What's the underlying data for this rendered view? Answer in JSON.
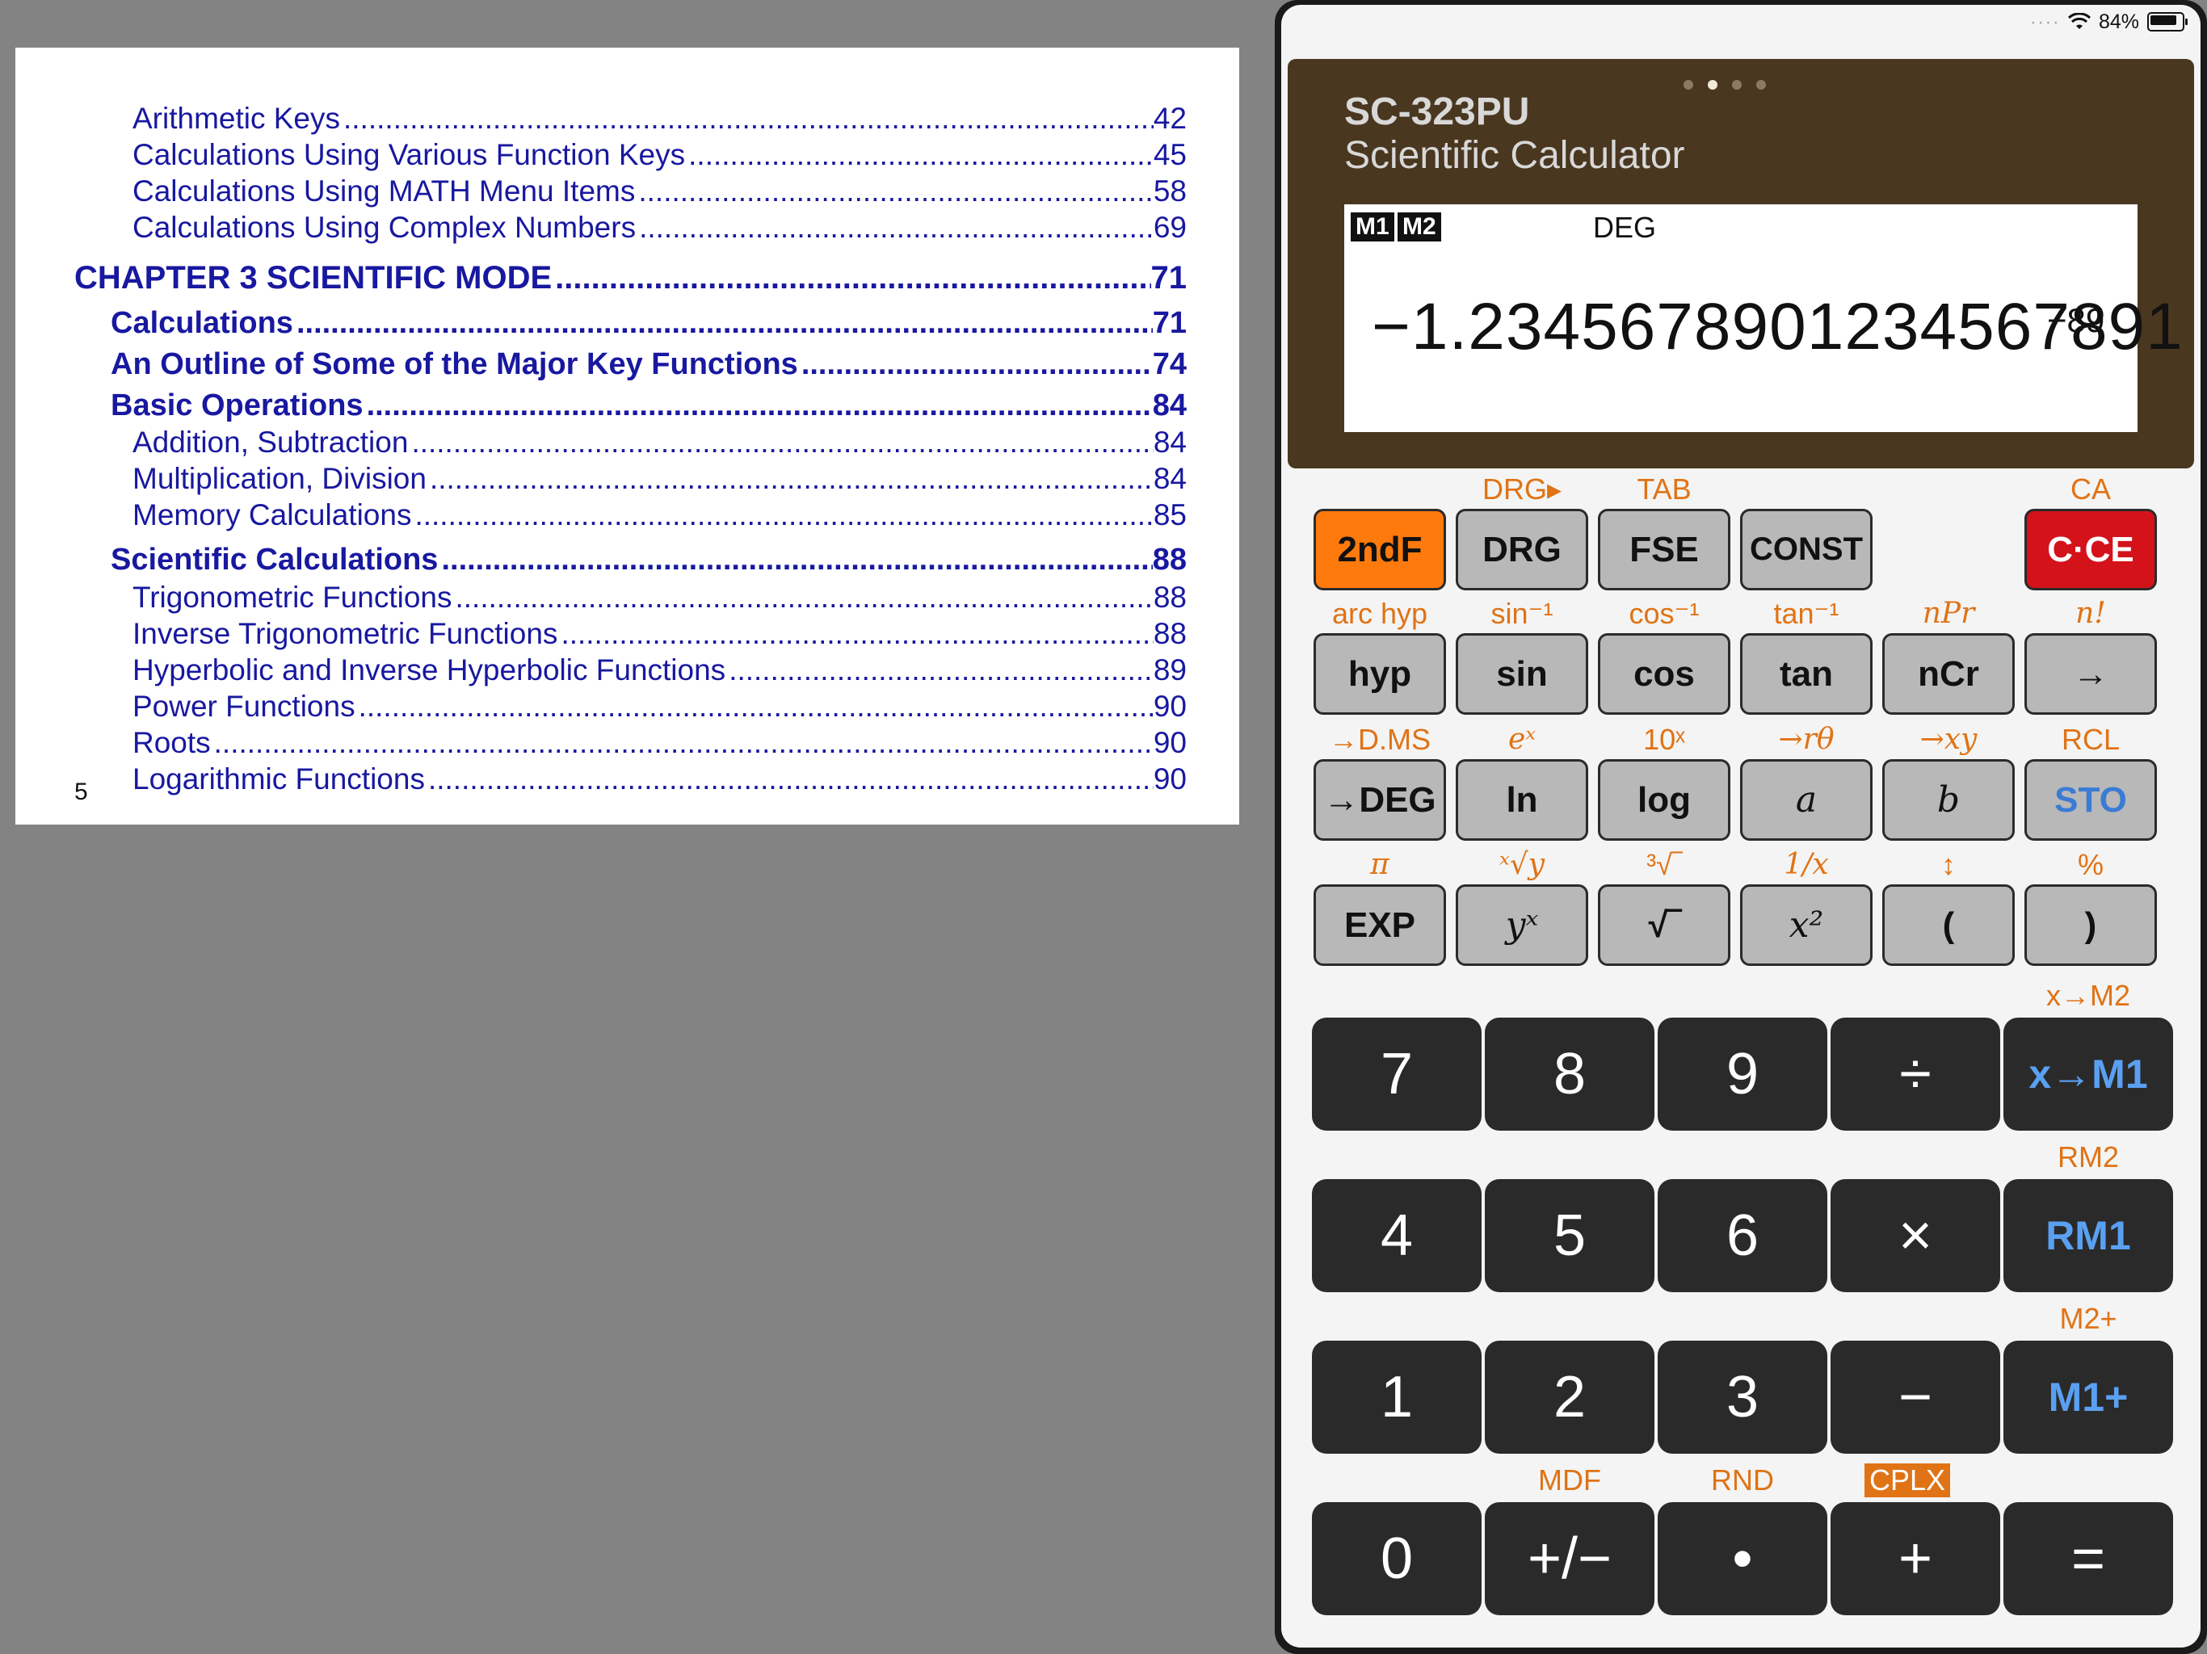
{
  "document": {
    "toc": [
      {
        "title": "Arithmetic Keys",
        "page": "42",
        "level": 3
      },
      {
        "title": "Calculations Using Various Function Keys",
        "page": "45",
        "level": 3
      },
      {
        "title": "Calculations Using MATH Menu Items",
        "page": "58",
        "level": 3
      },
      {
        "title": "Calculations Using Complex Numbers",
        "page": "69",
        "level": 3
      },
      {
        "title": "CHAPTER 3 SCIENTIFIC MODE",
        "page": "71",
        "level": 1
      },
      {
        "title": "Calculations",
        "page": "71",
        "level": 2
      },
      {
        "title": "An Outline of Some of the Major Key Functions",
        "page": "74",
        "level": 2
      },
      {
        "title": "Basic Operations",
        "page": "84",
        "level": 2
      },
      {
        "title": "Addition, Subtraction",
        "page": "84",
        "level": 3
      },
      {
        "title": "Multiplication, Division",
        "page": "84",
        "level": 3
      },
      {
        "title": "Memory Calculations",
        "page": "85",
        "level": 3
      },
      {
        "title": "Scientific Calculations",
        "page": "88",
        "level": 2
      },
      {
        "title": "Trigonometric Functions",
        "page": "88",
        "level": 3
      },
      {
        "title": "Inverse Trigonometric Functions",
        "page": "88",
        "level": 3
      },
      {
        "title": "Hyperbolic and Inverse Hyperbolic Functions",
        "page": "89",
        "level": 3
      },
      {
        "title": "Power Functions",
        "page": "90",
        "level": 3
      },
      {
        "title": "Roots",
        "page": "90",
        "level": 3
      },
      {
        "title": "Logarithmic Functions",
        "page": "90",
        "level": 3
      }
    ],
    "page_number": "5"
  },
  "status_bar": {
    "battery": "84%",
    "icons": [
      "signal-dots-icon",
      "wifi-icon",
      "battery-icon"
    ]
  },
  "calculator": {
    "model": "SC-323PU",
    "subtitle": "Scientific Calculator",
    "page_indicator": {
      "count": 4,
      "active": 2
    },
    "display": {
      "memory_indicators": [
        "M1",
        "M2"
      ],
      "mode": "DEG",
      "value": "−1.2345678901234567891",
      "exponent": "−89"
    },
    "key_rows": [
      [
        {
          "label": "2ndF",
          "second": "",
          "style": "orange"
        },
        {
          "label": "DRG",
          "second": "DRG▸",
          "style": "gray"
        },
        {
          "label": "FSE",
          "second": "TAB",
          "style": "gray"
        },
        {
          "label": "CONST",
          "second": "",
          "style": "gray"
        },
        null,
        {
          "label": "C·CE",
          "second": "CA",
          "style": "red"
        }
      ],
      [
        {
          "label": "hyp",
          "second": "arc hyp",
          "style": "gray"
        },
        {
          "label": "sin",
          "second": "sin⁻¹",
          "style": "gray"
        },
        {
          "label": "cos",
          "second": "cos⁻¹",
          "style": "gray"
        },
        {
          "label": "tan",
          "second": "tan⁻¹",
          "style": "gray"
        },
        {
          "label": "nCr",
          "second": "nPr",
          "style": "gray"
        },
        {
          "label": "→",
          "second": "n!",
          "style": "gray"
        }
      ],
      [
        {
          "label": "→DEG",
          "second": "→D.MS",
          "style": "gray"
        },
        {
          "label": "ln",
          "second": "eˣ",
          "style": "gray"
        },
        {
          "label": "log",
          "second": "10ˣ",
          "style": "gray"
        },
        {
          "label": "a",
          "second": "→rθ",
          "style": "serif"
        },
        {
          "label": "b",
          "second": "→xy",
          "style": "serif"
        },
        {
          "label": "STO",
          "second": "RCL",
          "style": "blue"
        }
      ],
      [
        {
          "label": "EXP",
          "second": "π",
          "style": "gray"
        },
        {
          "label": "yˣ",
          "second": "ˣ√y",
          "style": "serif"
        },
        {
          "label": "√‾",
          "second": "³√‾",
          "style": "gray"
        },
        {
          "label": "x²",
          "second": "1/x",
          "style": "serif"
        },
        {
          "label": "(",
          "second": "↕",
          "style": "gray"
        },
        {
          "label": ")",
          "second": "%",
          "style": "gray"
        }
      ]
    ],
    "numpad_rows": [
      {
        "keys": [
          "7",
          "8",
          "9",
          "÷",
          "x→M1"
        ],
        "second": [
          "",
          "",
          "",
          "",
          "x→M2"
        ]
      },
      {
        "keys": [
          "4",
          "5",
          "6",
          "×",
          "RM1"
        ],
        "second": [
          "",
          "",
          "",
          "",
          "RM2"
        ]
      },
      {
        "keys": [
          "1",
          "2",
          "3",
          "−",
          "M1+"
        ],
        "second": [
          "",
          "",
          "",
          "",
          "M2+"
        ]
      },
      {
        "keys": [
          "0",
          "+/−",
          "•",
          "+",
          "="
        ],
        "second": [
          "",
          "MDF",
          "RND",
          "CPLX",
          ""
        ]
      }
    ],
    "colors": {
      "shift_label": "#e07315",
      "memory_key": "#5aa0f2",
      "panel": "#4a3720",
      "accent_2ndF": "#ff7a0d",
      "clear": "#d4121a"
    }
  }
}
